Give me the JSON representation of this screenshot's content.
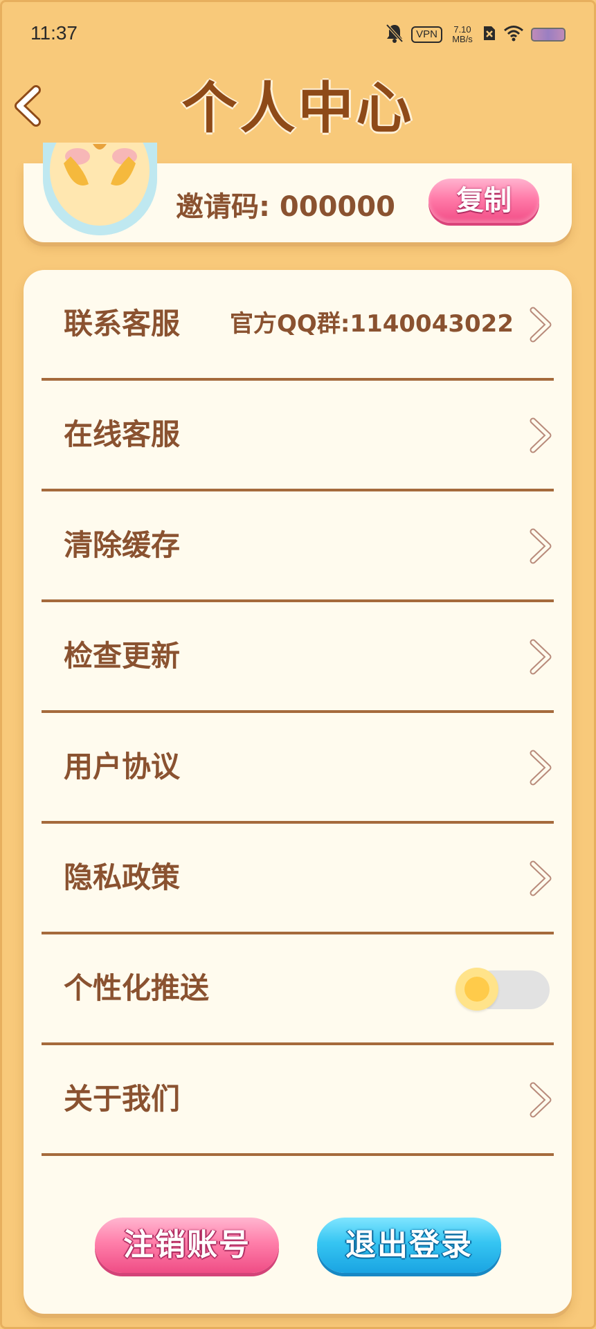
{
  "status_bar": {
    "time": "11:37",
    "vpn": "VPN",
    "speed_value": "7.10",
    "speed_unit": "MB/s"
  },
  "header": {
    "title": "个人中心",
    "back_icon": "chevron-left-icon"
  },
  "profile": {
    "invite_label": "邀请码: 000000",
    "copy_label": "复制"
  },
  "menu": {
    "items": [
      {
        "label": "联系客服",
        "value": "官方QQ群:1140043022"
      },
      {
        "label": "在线客服"
      },
      {
        "label": "清除缓存"
      },
      {
        "label": "检查更新"
      },
      {
        "label": "用户协议"
      },
      {
        "label": "隐私政策"
      },
      {
        "label": "个性化推送",
        "toggle_on": false
      },
      {
        "label": "关于我们"
      }
    ]
  },
  "actions": {
    "cancel_account": "注销账号",
    "logout": "退出登录"
  },
  "colors": {
    "background": "#F8C97A",
    "card": "#FFFBEE",
    "text": "#8A5230",
    "divider": "#A56A3C",
    "title": "#8E4A18",
    "pink_button": "#FF7BA9",
    "blue_button": "#36C5F2"
  }
}
